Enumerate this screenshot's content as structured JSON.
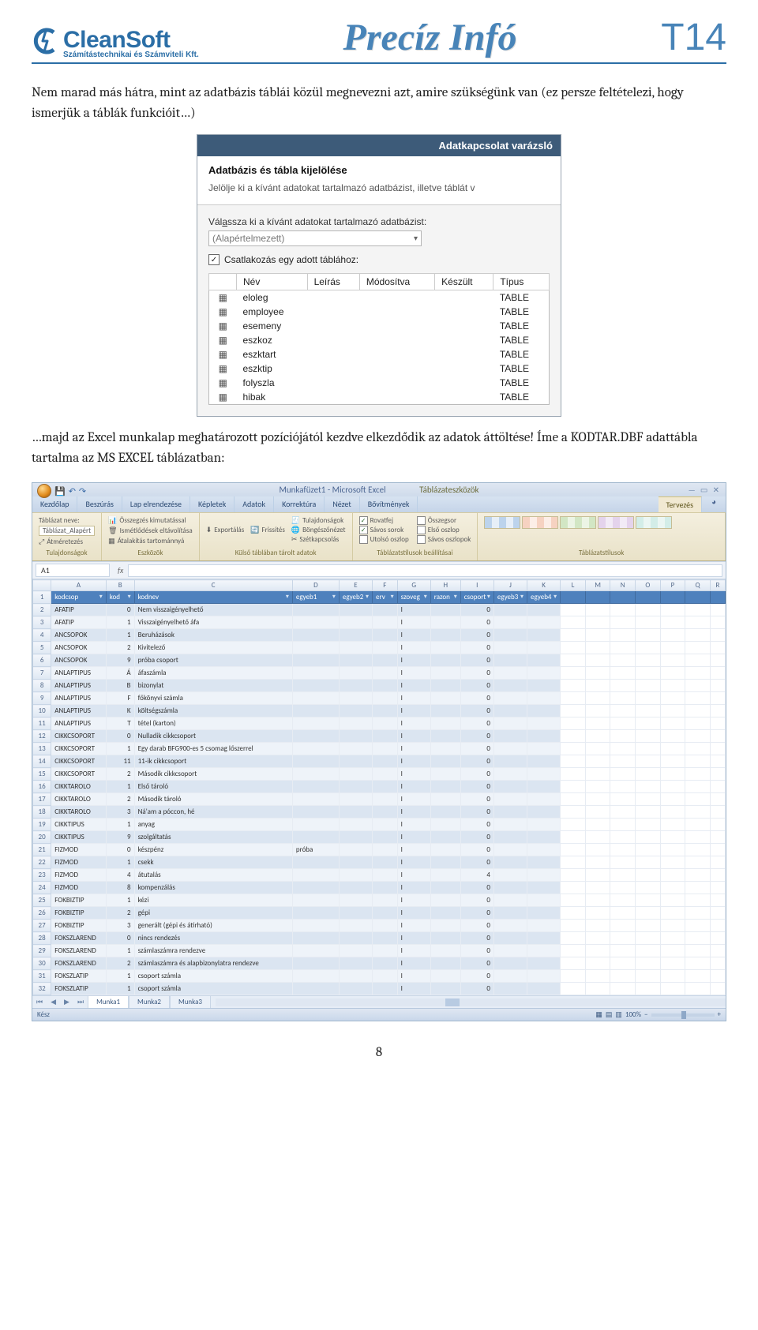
{
  "header": {
    "logo_name": "CleanSoft",
    "logo_tag": "Számítástechnikai és Számviteli Kft.",
    "title": "Precíz Infó",
    "code": "T14"
  },
  "para1": "Nem marad más hátra, mint az adatbázis táblái közül megnevezni azt, amire szükségünk van (ez persze feltételezi, hogy ismerjük a táblák funkcióit…)",
  "wizard": {
    "title": "Adatkapcsolat varázsló",
    "heading": "Adatbázis és tábla kijelölése",
    "sub": "Jelölje ki a kívánt adatokat tartalmazó adatbázist, illetve táblát v",
    "db_label_pre": "Vál",
    "db_label_u": "a",
    "db_label_post": "ssza ki a kívánt adatokat tartalmazó adatbázist:",
    "db_value": "(Alapértelmezett)",
    "chk_label_pre": "",
    "chk_label_u": "C",
    "chk_label_post": "satlakozás egy adott táblához:",
    "cols": [
      "Név",
      "Leírás",
      "Módosítva",
      "Készült",
      "Típus"
    ],
    "rows": [
      {
        "name": "eloleg",
        "type": "TABLE"
      },
      {
        "name": "employee",
        "type": "TABLE"
      },
      {
        "name": "esemeny",
        "type": "TABLE"
      },
      {
        "name": "eszkoz",
        "type": "TABLE"
      },
      {
        "name": "eszktart",
        "type": "TABLE"
      },
      {
        "name": "eszktip",
        "type": "TABLE"
      },
      {
        "name": "folyszla",
        "type": "TABLE"
      },
      {
        "name": "hibak",
        "type": "TABLE"
      }
    ]
  },
  "para2": "…majd az Excel munkalap meghatározott pozíciójától kezdve elkezdődik az adatok áttöltése! Íme a KODTAR.DBF adattábla tartalma az MS EXCEL táblázatban:",
  "excel": {
    "title": "Munkafüzet1 - Microsoft Excel",
    "ctx_group": "Táblázateszközök",
    "tabs": [
      "Kezdőlap",
      "Beszúrás",
      "Lap elrendezése",
      "Képletek",
      "Adatok",
      "Korrektúra",
      "Nézet",
      "Bővítmények"
    ],
    "ctx_tab": "Tervezés",
    "ribbon": {
      "g1_name": "Tulajdonságok",
      "g1_lbl_name": "Táblázat neve:",
      "g1_name_val": "Táblázat_Alapért",
      "g1_resize": "Átméretezés",
      "g2_name": "Eszközök",
      "g2_pivot": "Összegzés kimutatással",
      "g2_dup": "Ismétlődések eltávolítása",
      "g2_conv": "Átalakítás tartománnyá",
      "g3_name": "Külső táblában tárolt adatok",
      "g3_export": "Exportálás",
      "g3_refresh": "Frissítés",
      "g3_prop": "Tulajdonságok",
      "g3_browser": "Böngészőnézet",
      "g3_unlink": "Szétkapcsolás",
      "g4_name": "Táblázatstílusok beállításai",
      "g4_opts": [
        {
          "label": "Rovatfej",
          "checked": true
        },
        {
          "label": "Összegsor",
          "checked": false
        },
        {
          "label": "Sávos sorok",
          "checked": true
        },
        {
          "label": "Első oszlop",
          "checked": false
        },
        {
          "label": "Utolsó oszlop",
          "checked": false
        },
        {
          "label": "Sávos oszlopok",
          "checked": false
        }
      ],
      "g5_name": "Táblázatstílusok"
    },
    "namebox": "A1",
    "colheads": [
      "A",
      "B",
      "C",
      "D",
      "E",
      "F",
      "G",
      "H",
      "I",
      "J",
      "K",
      "L",
      "M",
      "N",
      "O",
      "P",
      "Q",
      "R"
    ],
    "header_row": [
      "kodcsop",
      "kod",
      "kodnev",
      "egyeb1",
      "egyeb2",
      "erv",
      "szoveg",
      "razon",
      "csoport",
      "egyeb3",
      "egyeb4"
    ],
    "rows": [
      {
        "n": 2,
        "a": "AFATIP",
        "b": "0",
        "c": "Nem visszaigényelhető",
        "g": "I",
        "i": "0"
      },
      {
        "n": 3,
        "a": "AFATIP",
        "b": "1",
        "c": "Visszaigényelhető áfa",
        "g": "I",
        "i": "0"
      },
      {
        "n": 4,
        "a": "ANCSOPOK",
        "b": "1",
        "c": "Beruházások",
        "g": "I",
        "i": "0"
      },
      {
        "n": 5,
        "a": "ANCSOPOK",
        "b": "2",
        "c": "Kivitelező",
        "g": "I",
        "i": "0"
      },
      {
        "n": 6,
        "a": "ANCSOPOK",
        "b": "9",
        "c": "próba csoport",
        "g": "I",
        "i": "0"
      },
      {
        "n": 7,
        "a": "ANLAPTIPUS",
        "b": "Á",
        "c": "áfaszámla",
        "g": "I",
        "i": "0"
      },
      {
        "n": 8,
        "a": "ANLAPTIPUS",
        "b": "B",
        "c": "bizonylat",
        "g": "I",
        "i": "0"
      },
      {
        "n": 9,
        "a": "ANLAPTIPUS",
        "b": "F",
        "c": "főkönyvi számla",
        "g": "I",
        "i": "0"
      },
      {
        "n": 10,
        "a": "ANLAPTIPUS",
        "b": "K",
        "c": "költségszámla",
        "g": "I",
        "i": "0"
      },
      {
        "n": 11,
        "a": "ANLAPTIPUS",
        "b": "T",
        "c": "tétel (karton)",
        "g": "I",
        "i": "0"
      },
      {
        "n": 12,
        "a": "CIKKCSOPORT",
        "b": "0",
        "c": "Nulladik cikkcsoport",
        "g": "I",
        "i": "0"
      },
      {
        "n": 13,
        "a": "CIKKCSOPORT",
        "b": "1",
        "c": "Egy darab BFG900-es 5 csomag lőszerrel",
        "g": "I",
        "i": "0"
      },
      {
        "n": 14,
        "a": "CIKKCSOPORT",
        "b": "11",
        "c": "11-ik cikkcsoport",
        "g": "I",
        "i": "0"
      },
      {
        "n": 15,
        "a": "CIKKCSOPORT",
        "b": "2",
        "c": "Második cikkcsoport",
        "g": "I",
        "i": "0"
      },
      {
        "n": 16,
        "a": "CIKKTAROLO",
        "b": "1",
        "c": "Első tároló",
        "g": "I",
        "i": "0"
      },
      {
        "n": 17,
        "a": "CIKKTAROLO",
        "b": "2",
        "c": "Második tároló",
        "g": "I",
        "i": "0"
      },
      {
        "n": 18,
        "a": "CIKKTAROLO",
        "b": "3",
        "c": "Ná'am a póccon, hé",
        "g": "I",
        "i": "0"
      },
      {
        "n": 19,
        "a": "CIKKTIPUS",
        "b": "1",
        "c": "anyag",
        "g": "I",
        "i": "0"
      },
      {
        "n": 20,
        "a": "CIKKTIPUS",
        "b": "9",
        "c": "szolgáltatás",
        "g": "I",
        "i": "0"
      },
      {
        "n": 21,
        "a": "FIZMOD",
        "b": "0",
        "c": "készpénz",
        "d": "próba",
        "g": "I",
        "i": "0"
      },
      {
        "n": 22,
        "a": "FIZMOD",
        "b": "1",
        "c": "csekk",
        "g": "I",
        "i": "0"
      },
      {
        "n": 23,
        "a": "FIZMOD",
        "b": "4",
        "c": "átutalás",
        "g": "I",
        "i": "4"
      },
      {
        "n": 24,
        "a": "FIZMOD",
        "b": "8",
        "c": "kompenzálás",
        "g": "I",
        "i": "0"
      },
      {
        "n": 25,
        "a": "FOKBIZTIP",
        "b": "1",
        "c": "kézi",
        "g": "I",
        "i": "0"
      },
      {
        "n": 26,
        "a": "FOKBIZTIP",
        "b": "2",
        "c": "gépi",
        "g": "I",
        "i": "0"
      },
      {
        "n": 27,
        "a": "FOKBIZTIP",
        "b": "3",
        "c": "generált (gépi és átírható)",
        "g": "I",
        "i": "0"
      },
      {
        "n": 28,
        "a": "FOKSZLAREND",
        "b": "0",
        "c": "nincs rendezés",
        "g": "I",
        "i": "0"
      },
      {
        "n": 29,
        "a": "FOKSZLAREND",
        "b": "1",
        "c": "számlaszámra rendezve",
        "g": "I",
        "i": "0"
      },
      {
        "n": 30,
        "a": "FOKSZLAREND",
        "b": "2",
        "c": "számlaszámra és alapbizonylatra rendezve",
        "g": "I",
        "i": "0"
      },
      {
        "n": 31,
        "a": "FOKSZLATIP",
        "b": "1",
        "c": "csoport számla",
        "g": "I",
        "i": "0"
      },
      {
        "n": 32,
        "a": "FOKSZLATIP",
        "b": "1",
        "c": "csoport számla",
        "g": "I",
        "i": "0"
      }
    ],
    "sheets": [
      "Munka1",
      "Munka2",
      "Munka3"
    ],
    "status": "Kész",
    "zoom": "100%"
  },
  "page_number": "8"
}
